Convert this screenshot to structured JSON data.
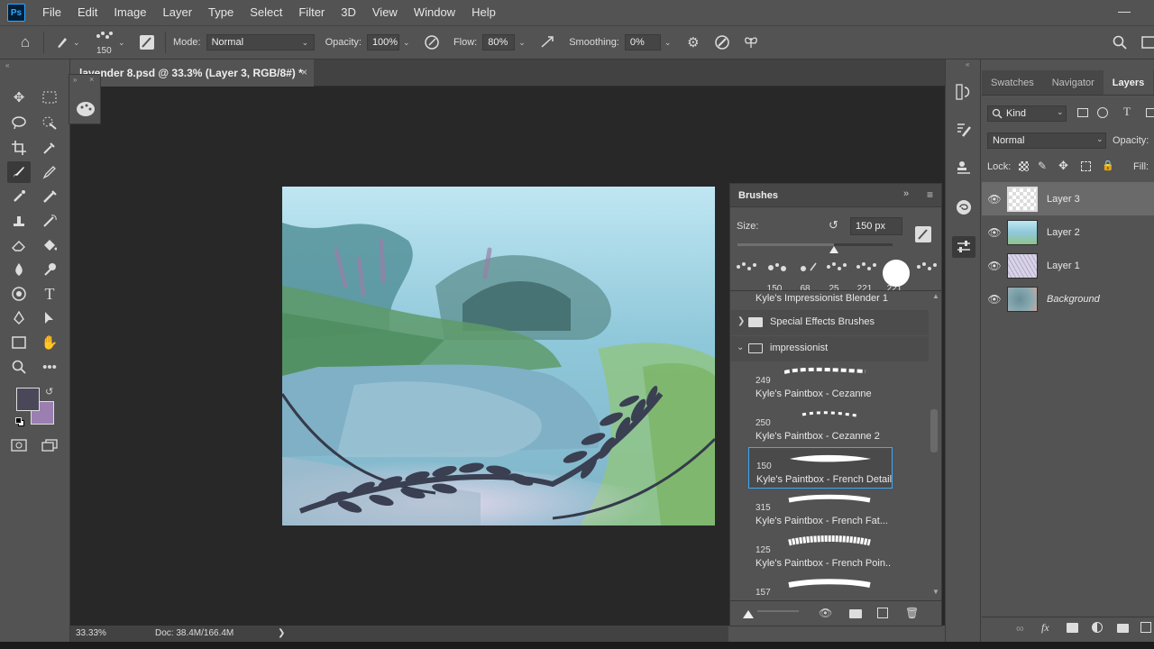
{
  "app": {
    "logo": "Ps"
  },
  "menu": [
    "File",
    "Edit",
    "Image",
    "Layer",
    "Type",
    "Select",
    "Filter",
    "3D",
    "View",
    "Window",
    "Help"
  ],
  "options": {
    "brush_size": "150",
    "mode_label": "Mode:",
    "mode_value": "Normal",
    "opacity_label": "Opacity:",
    "opacity_value": "100%",
    "flow_label": "Flow:",
    "flow_value": "80%",
    "smoothing_label": "Smoothing:",
    "smoothing_value": "0%"
  },
  "document": {
    "tab_title": "lavender 8.psd @ 33.3% (Layer 3, RGB/8#) *",
    "close": "×"
  },
  "status": {
    "zoom": "33.33%",
    "doc_size": "Doc: 38.4M/166.4M",
    "arrow": "❯"
  },
  "brushes_panel": {
    "title": "Brushes",
    "size_label": "Size:",
    "size_value": "150 px",
    "size_fraction": 0.62,
    "recent_tips": [
      "150",
      "68",
      "25",
      "221",
      "221",
      "",
      "221"
    ],
    "current_brush": "Kyle's Impressionist Blender 1",
    "folders": [
      {
        "name": "Special Effects Brushes",
        "expanded": false
      },
      {
        "name": "impressionist",
        "expanded": true
      }
    ],
    "brushes": [
      {
        "size": "249",
        "name": "Kyle's Paintbox - Cezanne",
        "selected": false
      },
      {
        "size": "250",
        "name": "Kyle's Paintbox - Cezanne 2",
        "selected": false
      },
      {
        "size": "150",
        "name": "Kyle's Paintbox - French Detail",
        "selected": true
      },
      {
        "size": "315",
        "name": "Kyle's Paintbox - French Fat...",
        "selected": false
      },
      {
        "size": "125",
        "name": "Kyle's Paintbox - French Poin...",
        "selected": false
      },
      {
        "size": "157",
        "name": "",
        "selected": false
      }
    ]
  },
  "panel_tabs": [
    {
      "label": "Swatches",
      "active": false
    },
    {
      "label": "Navigator",
      "active": false
    },
    {
      "label": "Layers",
      "active": true
    }
  ],
  "layers_panel": {
    "filter_kind": "Kind",
    "blend_mode": "Normal",
    "opacity_label": "Opacity:",
    "lock_label": "Lock:",
    "fill_label": "Fill:",
    "layers": [
      {
        "name": "Layer 3",
        "selected": true,
        "italic": false
      },
      {
        "name": "Layer 2",
        "selected": false,
        "italic": false
      },
      {
        "name": "Layer 1",
        "selected": false,
        "italic": false
      },
      {
        "name": "Background",
        "selected": false,
        "italic": true
      }
    ]
  },
  "colors": {
    "foreground": "#4a4858",
    "background": "#9b7fb0",
    "selection": "#3fa9f5"
  }
}
